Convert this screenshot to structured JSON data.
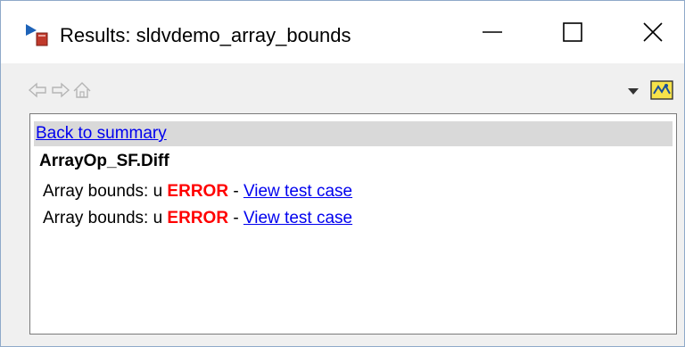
{
  "window": {
    "title": "Results: sldvdemo_array_bounds"
  },
  "toolbar": {
    "back_icon": "arrow-left-icon",
    "forward_icon": "arrow-right-icon",
    "home_icon": "home-icon",
    "dropdown_icon": "dropdown-arrow-icon",
    "model_icon": "model-map-icon"
  },
  "content": {
    "back_link": "Back to summary",
    "section_title": "ArrayOp_SF.Diff",
    "rows": [
      {
        "label": "Array bounds: u",
        "status": "ERROR",
        "separator": "-",
        "link": "View test case"
      },
      {
        "label": "Array bounds: u",
        "status": "ERROR",
        "separator": "-",
        "link": "View test case"
      }
    ]
  },
  "colors": {
    "error": "#ff0000",
    "link": "#0000ee",
    "summary_band": "#d9d9d9"
  }
}
